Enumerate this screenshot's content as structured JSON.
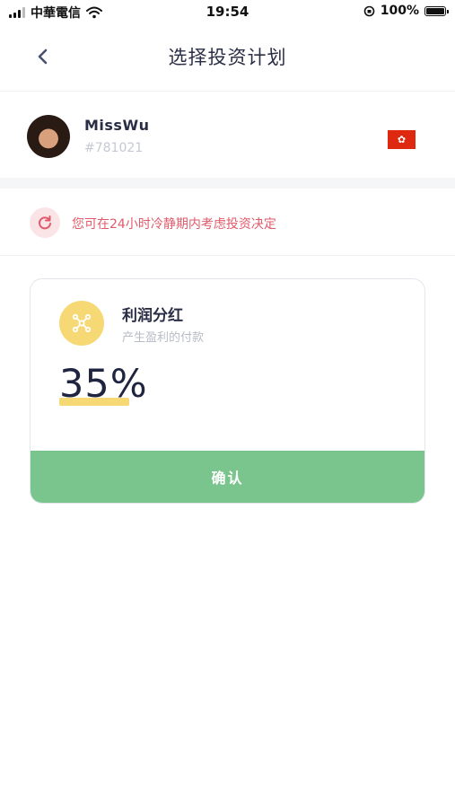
{
  "status_bar": {
    "carrier": "中華電信",
    "time": "19:54",
    "battery_percent": "100%"
  },
  "header": {
    "title": "选择投资计划"
  },
  "profile": {
    "username": "MissWu",
    "user_id": "#781021"
  },
  "notice": {
    "text": "您可在24小时冷静期内考虑投资决定"
  },
  "plan": {
    "title": "利润分红",
    "subtitle": "产生盈利的付款",
    "rate": "35%",
    "confirm_label": "确认"
  },
  "colors": {
    "accent_green": "#79c58d",
    "accent_yellow": "#f6d874",
    "notice_red": "#e05a6a",
    "flag_red": "#de2910"
  },
  "icons": {
    "back": "chevron-left-icon",
    "notice": "refresh-icon",
    "plan": "network-icon",
    "flag": "hong-kong-flag-icon"
  }
}
